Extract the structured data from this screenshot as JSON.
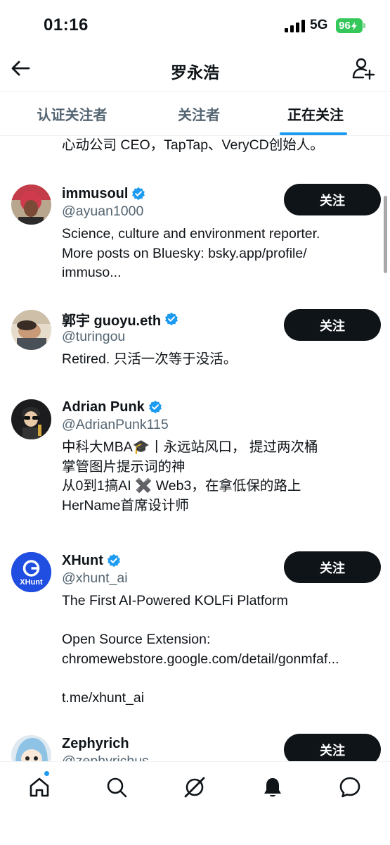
{
  "status_bar": {
    "time": "01:16",
    "network": "5G",
    "battery": "96"
  },
  "header": {
    "title": "罗永浩",
    "back_icon": "arrow-left-icon",
    "add_user_icon": "add-user-icon"
  },
  "tabs": [
    {
      "label": "认证关注者",
      "active": false
    },
    {
      "label": "关注者",
      "active": false
    },
    {
      "label": "正在关注",
      "active": true
    }
  ],
  "partial_bio": "心动公司 CEO，TapTap、VeryCD创始人。",
  "users": [
    {
      "name": "immusoul",
      "handle": "@ayuan1000",
      "verified": true,
      "button": "关注",
      "bio": [
        "Science, culture and environment reporter.",
        "More posts on Bluesky: bsky.app/profile/",
        "immuso..."
      ]
    },
    {
      "name": "郭宇 guoyu.eth",
      "handle": "@turingou",
      "verified": true,
      "button": "关注",
      "bio": [
        "Retired. 只活一次等于没活。"
      ]
    },
    {
      "name": "Adrian Punk",
      "handle": "@AdrianPunk115",
      "verified": true,
      "button": "",
      "bio": [
        "中科大MBA🎓丨永远站风口， 提过两次桶",
        "掌管图片提示词的神",
        "从0到1搞AI ✖️ Web3，在拿低保的路上",
        "HerName首席设计师"
      ]
    },
    {
      "name": "XHunt",
      "handle": "@xhunt_ai",
      "verified": true,
      "button": "关注",
      "avatar_text": "XHunt",
      "bio": [
        "The First AI-Powered KOLFi Platform",
        "",
        "Open Source Extension:",
        "chromewebstore.google.com/detail/gonmfaf...",
        "",
        "t.me/xhunt_ai"
      ]
    },
    {
      "name": "Zephyrich",
      "handle": "@zephyrichus",
      "verified": false,
      "button": "关注",
      "bio": []
    }
  ],
  "bottom_nav": [
    {
      "icon": "home-icon",
      "has_notification_dot": true
    },
    {
      "icon": "search-icon"
    },
    {
      "icon": "grok-icon"
    },
    {
      "icon": "bell-icon"
    },
    {
      "icon": "messages-icon"
    }
  ],
  "colors": {
    "accent": "#1d9bf0",
    "text": "#0f1419",
    "secondary_text": "#536471",
    "button_bg": "#0f1419",
    "battery": "#34c759"
  }
}
